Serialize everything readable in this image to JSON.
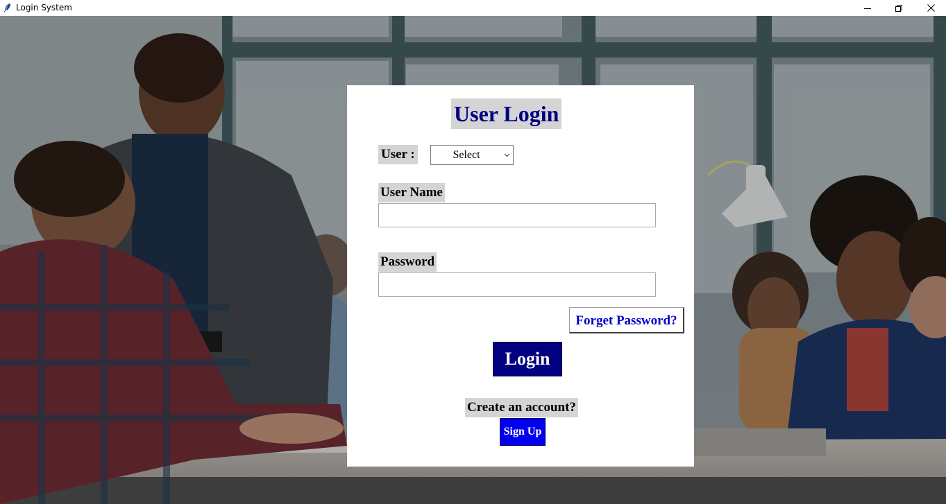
{
  "window": {
    "title": "Login System",
    "app_icon": "feather-icon",
    "controls": {
      "minimize_icon": "minimize-icon",
      "maximize_icon": "restore-icon",
      "close_icon": "close-icon"
    }
  },
  "background": {
    "description_icon": "office-team-photo"
  },
  "login": {
    "heading": "User Login",
    "user_label": "User :",
    "user_select": {
      "selected": "Select",
      "icon": "chevron-down-icon"
    },
    "username_label": "User Name",
    "username_value": "",
    "password_label": "Password",
    "password_value": "",
    "forgot_label": "Forget Password?",
    "login_label": "Login",
    "create_label": "Create an account?",
    "signup_label": "Sign Up"
  },
  "colors": {
    "heading": "#000080",
    "login_button": "#000080",
    "signup_button": "#0000ee",
    "forgot_text": "#0000cc",
    "label_bg": "#d4d4d4"
  }
}
